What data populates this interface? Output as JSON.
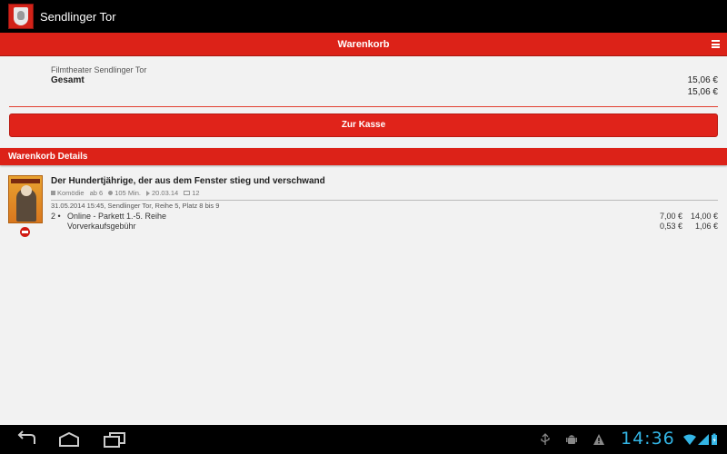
{
  "app": {
    "title": "Sendlinger Tor"
  },
  "header": {
    "title": "Warenkorb"
  },
  "summary": {
    "cinema": "Filmtheater Sendlinger Tor",
    "total_label": "Gesamt",
    "price_line1": "15,06 €",
    "price_line2": "15,06 €"
  },
  "checkout": {
    "label": "Zur Kasse"
  },
  "details": {
    "title": "Warenkorb Details"
  },
  "movie": {
    "title": "Der Hundertjährige, der aus dem Fenster stieg und verschwand",
    "genre": "Komödie",
    "age": "ab 6",
    "duration": "105 Min.",
    "release": "20.03.14",
    "tickets": "12",
    "show": "31.05.2014 15:45, Sendlinger Tor, Reihe 5, Platz 8 bis 9"
  },
  "items": [
    {
      "qty": "2 •",
      "desc": "Online - Parkett 1.-5. Reihe",
      "unit": "7,00 €",
      "sum": "14,00 €"
    },
    {
      "desc": "Vorverkaufsgebühr",
      "unit": "0,53 €",
      "sum": "1,06 €"
    }
  ],
  "statusbar": {
    "time": "14:36"
  },
  "colors": {
    "accent_red": "#dc2218",
    "clock_blue": "#33b5e5"
  }
}
